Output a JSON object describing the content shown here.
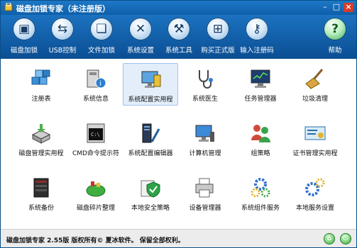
{
  "app": {
    "title": "磁盘加锁专家（未注册版）"
  },
  "window_buttons": {
    "minimize": "–",
    "maximize": "□",
    "close": "×"
  },
  "toolbar": [
    {
      "label": "磁盘加锁",
      "icon": "floppy-disk-icon"
    },
    {
      "label": "USB控制",
      "icon": "usb-drive-icon"
    },
    {
      "label": "文件加锁",
      "icon": "file-lock-icon"
    },
    {
      "label": "系统设置",
      "icon": "tools-icon"
    },
    {
      "label": "系统工具",
      "icon": "wrench-icon"
    },
    {
      "label": "购买正式版",
      "icon": "shopping-cart-icon"
    },
    {
      "label": "输入注册码",
      "icon": "key-icon"
    },
    {
      "label": "帮助",
      "icon": "help-icon"
    }
  ],
  "grid": [
    {
      "label": "注册表",
      "icon": "registry-cubes-icon"
    },
    {
      "label": "系统信息",
      "icon": "system-info-icon"
    },
    {
      "label": "系统配置实用程",
      "icon": "computer-config-icon"
    },
    {
      "label": "系统医生",
      "icon": "stethoscope-icon"
    },
    {
      "label": "任务管理器",
      "icon": "monitor-icon"
    },
    {
      "label": "垃圾清理",
      "icon": "broom-icon"
    },
    {
      "label": "磁盘管理实用程",
      "icon": "disk-management-icon"
    },
    {
      "label": "CMD命令提示符",
      "icon": "command-prompt-icon"
    },
    {
      "label": "系统配置编辑器",
      "icon": "config-editor-icon"
    },
    {
      "label": "计算机管理",
      "icon": "computer-management-icon"
    },
    {
      "label": "组策略",
      "icon": "group-policy-icon"
    },
    {
      "label": "证书管理实用程",
      "icon": "certificate-icon"
    },
    {
      "label": "系统备份",
      "icon": "server-backup-icon"
    },
    {
      "label": "磁盘碎片整理",
      "icon": "defrag-icon"
    },
    {
      "label": "本地安全策略",
      "icon": "security-shield-icon"
    },
    {
      "label": "设备管理器",
      "icon": "printer-device-icon"
    },
    {
      "label": "系统组件服务",
      "icon": "components-gear-icon"
    },
    {
      "label": "本地服务设置",
      "icon": "services-gear-icon"
    }
  ],
  "selected_index": 2,
  "status": {
    "text": "磁盘加锁专家 2.55版  版权所有© 夏冰软件。 保留全部权利。"
  },
  "colors": {
    "title_bar": "#1d78c7",
    "toolbar": "#0b4e93",
    "selection": "#e3eefa",
    "status_bar": "#ececec"
  }
}
